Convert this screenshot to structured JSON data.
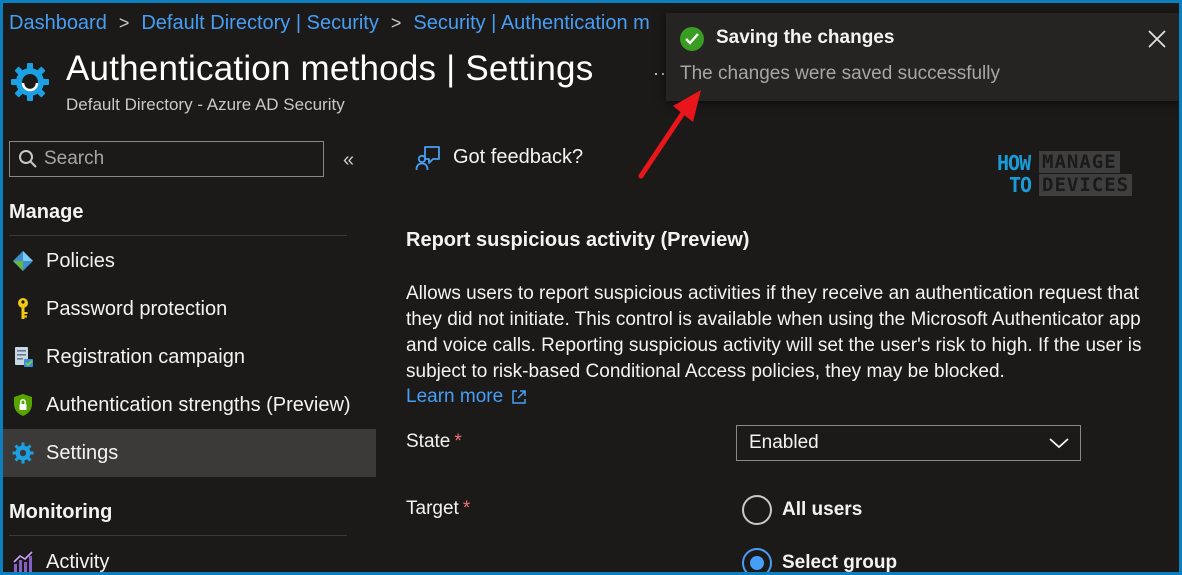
{
  "breadcrumb": {
    "items": [
      "Dashboard",
      "Default Directory | Security",
      "Security | Authentication m"
    ],
    "separator": ">"
  },
  "header": {
    "title": "Authentication methods | Settings",
    "subtitle": "Default Directory - Azure AD Security",
    "more": "··"
  },
  "toast": {
    "title": "Saving the changes",
    "message": "The changes were saved successfully"
  },
  "sidebar": {
    "search_placeholder": "Search",
    "collapse": "«",
    "sections": {
      "manage": "Manage",
      "monitoring": "Monitoring"
    },
    "items": [
      {
        "label": "Policies",
        "icon": "policy-icon"
      },
      {
        "label": "Password protection",
        "icon": "key-icon"
      },
      {
        "label": "Registration campaign",
        "icon": "registration-icon"
      },
      {
        "label": "Authentication strengths (Preview)",
        "icon": "shield-lock-icon"
      },
      {
        "label": "Settings",
        "icon": "gear-icon",
        "selected": true
      },
      {
        "label": "Activity",
        "icon": "activity-chart-icon"
      }
    ]
  },
  "main": {
    "feedback": "Got feedback?",
    "watermark": {
      "how": "HOW",
      "to": "TO",
      "manage": "MANAGE",
      "devices": "DEVICES"
    },
    "section_title": "Report suspicious activity (Preview)",
    "description": "Allows users to report suspicious activities if they receive an authentication request that they did not initiate. This control is available when using the Microsoft Authenticator app and voice calls. Reporting suspicious activity will set the user's risk to high. If the user is subject to risk-based Conditional Access policies, they may be blocked.",
    "learn_more": "Learn more",
    "state": {
      "label": "State",
      "required": "*",
      "value": "Enabled"
    },
    "target": {
      "label": "Target",
      "required": "*",
      "options": [
        {
          "label": "All users",
          "checked": false
        },
        {
          "label": "Select group",
          "checked": true
        }
      ]
    }
  },
  "colors": {
    "accent": "#479ef5",
    "success": "#3a9d23",
    "required": "#f1707b",
    "annotation": "#e8151b"
  }
}
